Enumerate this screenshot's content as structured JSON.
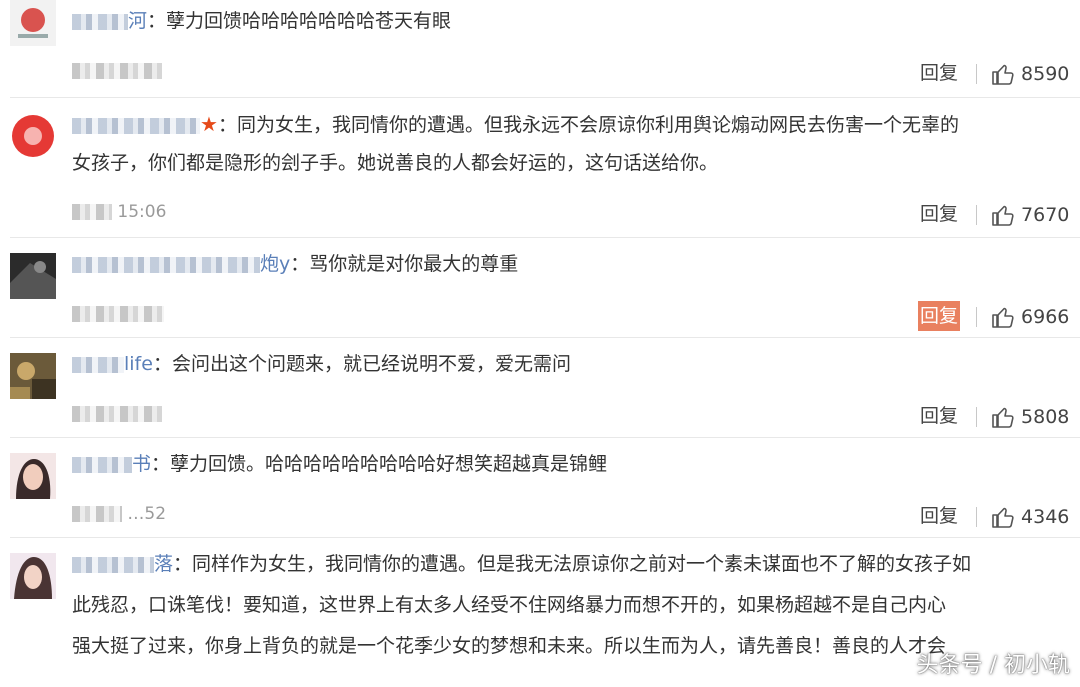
{
  "comments": [
    {
      "username_suffix": "河",
      "text_lines": [
        "：孽力回馈哈哈哈哈哈哈哈苍天有眼"
      ],
      "time": "",
      "reply_label": "回复",
      "reply_highlighted": false,
      "likes": "8590"
    },
    {
      "username_suffix": "",
      "text_lines": [
        "：同为女生，我同情你的遭遇。但我永远不会原谅你利用舆论煽动网民去伤害一个无辜的",
        "女孩子，你们都是隐形的刽子手。她说善良的人都会好运的，这句话送给你。"
      ],
      "time": "15:06",
      "reply_label": "回复",
      "reply_highlighted": false,
      "likes": "7670"
    },
    {
      "username_suffix": "炮y",
      "text_lines": [
        "：骂你就是对你最大的尊重"
      ],
      "time": "",
      "reply_label": "回复",
      "reply_highlighted": true,
      "likes": "6966"
    },
    {
      "username_suffix": "life",
      "text_lines": [
        "：会问出这个问题来，就已经说明不爱，爱无需问"
      ],
      "time": "",
      "reply_label": "回复",
      "reply_highlighted": false,
      "likes": "5808"
    },
    {
      "username_suffix": "书",
      "text_lines": [
        "：孽力回馈。哈哈哈哈哈哈哈哈哈好想笑超越真是锦鲤"
      ],
      "time": "…52",
      "reply_label": "回复",
      "reply_highlighted": false,
      "likes": "4346"
    },
    {
      "username_suffix": "落",
      "text_lines": [
        "：同样作为女生，我同情你的遭遇。但是我无法原谅你之前对一个素未谋面也不了解的女孩子如",
        "此残忍，口诛笔伐！要知道，这世界上有太多人经受不住网络暴力而想不开的，如果杨超越不是自己内心",
        "强大挺了过来，你身上背负的就是一个花季少女的梦想和未来。所以生而为人，请先善良！善良的人才会"
      ],
      "time": "",
      "reply_label": "",
      "reply_highlighted": false,
      "likes": ""
    }
  ],
  "watermark": "头条号 / 初小轨",
  "colors": {
    "username": "#5a7fb8",
    "reply_highlight": "#e9805f",
    "star": "#e64a19"
  },
  "icons": {
    "like": "thumbs-up-icon",
    "badge": "star-icon"
  }
}
